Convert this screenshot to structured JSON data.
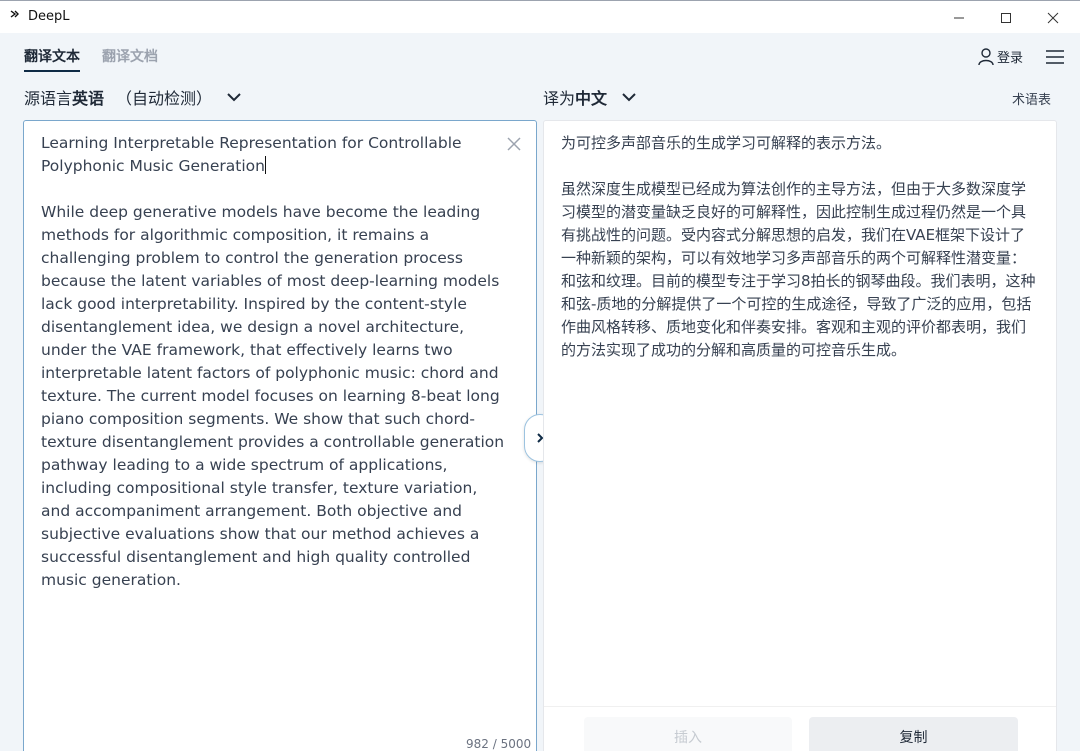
{
  "window": {
    "icon_glyph": "3>",
    "title": "DeepL",
    "minimize": "—",
    "maximize": "☐",
    "close": "✕"
  },
  "tabs": [
    {
      "label": "翻译文本",
      "active": true
    },
    {
      "label": "翻译文档",
      "active": false
    }
  ],
  "header": {
    "login_label": "登录",
    "login_icon": "user-icon",
    "menu_icon": "hamburger-menu-icon"
  },
  "source": {
    "prefix": "源语言",
    "language": "英语",
    "detect": "（自动检测）",
    "text": "Learning Interpretable Representation for Controllable Polyphonic Music Generation",
    "body": "While deep generative models have become the leading methods for algorithmic composition, it remains a challenging problem to control the generation process because the latent variables of most deep-learning models lack good interpretability. Inspired by the content-style disentanglement idea, we design a novel architecture, under the VAE framework, that effectively learns two interpretable latent factors of polyphonic music: chord and texture. The current model focuses on learning 8-beat long piano composition segments. We show that such chord-texture disentanglement provides a controllable generation pathway leading to a wide spectrum of applications, including compositional style transfer, texture variation, and accompaniment arrangement. Both objective and subjective evaluations show that our method achieves a successful disentanglement and high quality controlled music generation.",
    "clear": "✕",
    "char_count": "982 / 5000"
  },
  "target": {
    "prefix": "译为",
    "language": "中文",
    "glossary": "术语表",
    "title": "为可控多声部音乐的生成学习可解释的表示方法。",
    "body": "虽然深度生成模型已经成为算法创作的主导方法，但由于大多数深度学习模型的潜变量缺乏良好的可解释性，因此控制生成过程仍然是一个具有挑战性的问题。受内容式分解思想的启发，我们在VAE框架下设计了一种新颖的架构，可以有效地学习多声部音乐的两个可解释性潜变量：和弦和纹理。目前的模型专注于学习8拍长的钢琴曲段。我们表明，这种和弦-质地的分解提供了一个可控的生成途径，导致了广泛的应用，包括作曲风格转移、质地变化和伴奏安排。客观和主观的评价都表明，我们的方法实现了成功的分解和高质量的可控音乐生成。",
    "insert_label": "插入",
    "copy_label": "复制"
  },
  "colors": {
    "accent": "#0f2b46",
    "panel_border_active": "#7aa7cc",
    "background": "#f1f5f9"
  }
}
